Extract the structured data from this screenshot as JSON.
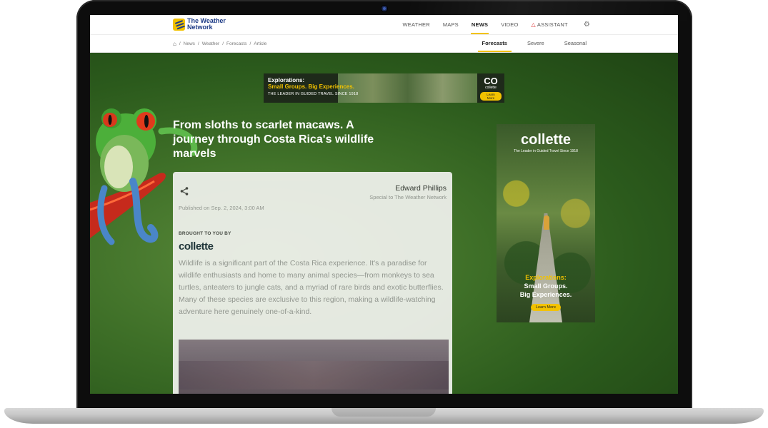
{
  "site": {
    "logo_line1": "The Weather",
    "logo_line2": "Network"
  },
  "nav": {
    "items": [
      {
        "label": "WEATHER"
      },
      {
        "label": "MAPS"
      },
      {
        "label": "NEWS"
      },
      {
        "label": "VIDEO"
      },
      {
        "label": "ASSISTANT"
      }
    ],
    "active": "NEWS"
  },
  "breadcrumb": {
    "items": [
      "News",
      "Weather",
      "Forecasts",
      "Article"
    ]
  },
  "subtabs": {
    "items": [
      {
        "label": "Forecasts"
      },
      {
        "label": "Severe"
      },
      {
        "label": "Seasonal"
      }
    ],
    "active": "Forecasts"
  },
  "top_ad": {
    "line1": "Explorations:",
    "line2": "Small Groups. Big Experiences.",
    "line3": "THE LEADER IN GUIDED TRAVEL SINCE 1918",
    "brand_mark": "CO",
    "brand_name": "collette",
    "cta": "Learn More"
  },
  "article": {
    "headline": "From sloths to scarlet macaws. A journey through Costa Rica's wildlife marvels",
    "author_name": "Edward Phillips",
    "author_role": "Special to The Weather Network",
    "published": "Published on Sep. 2, 2024, 3:00 AM",
    "brought_label": "BROUGHT TO YOU BY",
    "sponsor": "collette",
    "body": "Wildlife is a significant part of the Costa Rica experience. It's a paradise for wildlife enthusiasts and home to many animal species—from monkeys to sea turtles, anteaters to jungle cats, and a myriad of rare birds and exotic butterflies. Many of these species are exclusive to this region, making a wildlife-watching adventure here genuinely one-of-a-kind."
  },
  "side_ad": {
    "brand": "collette",
    "tagline": "The Leader in Guided Travel Since 1918",
    "line1": "Explorations:",
    "line2": "Small Groups.",
    "line3": "Big Experiences.",
    "cta": "Learn More"
  },
  "colors": {
    "accent": "#f2c200",
    "brand_blue": "#1d3b86",
    "hero_green": "#3f7028"
  }
}
